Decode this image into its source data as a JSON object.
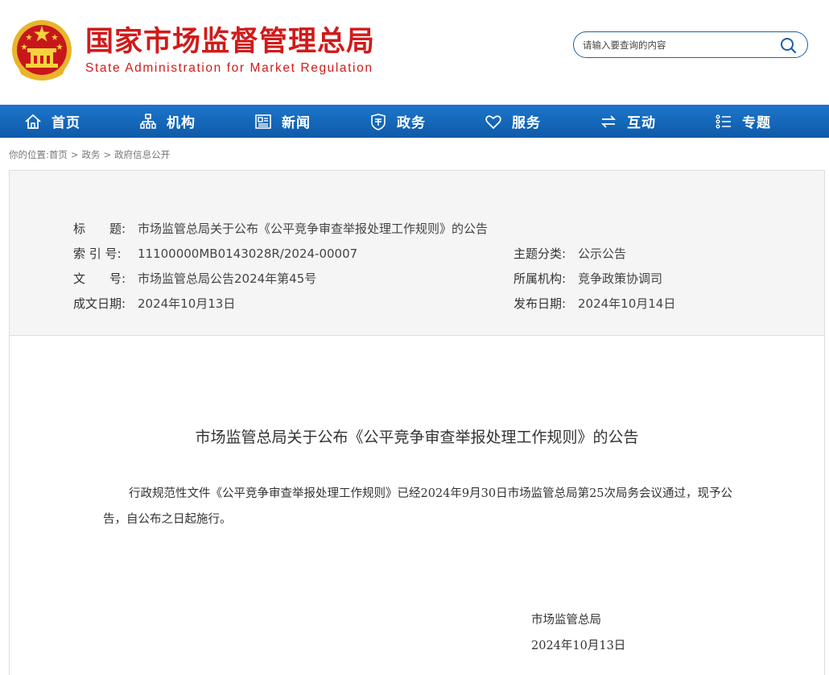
{
  "header": {
    "logo_cn": "国家市场监督管理总局",
    "logo_en": "State Administration for Market Regulation",
    "search_placeholder": "请输入要查询的内容",
    "brand_red": "#d11a1a",
    "brand_blue": "#1166bb"
  },
  "nav": {
    "items": [
      {
        "label": "首页",
        "icon": "home-icon"
      },
      {
        "label": "机构",
        "icon": "org-chart-icon"
      },
      {
        "label": "新闻",
        "icon": "news-icon"
      },
      {
        "label": "政务",
        "icon": "government-affairs-icon"
      },
      {
        "label": "服务",
        "icon": "heart-icon"
      },
      {
        "label": "互动",
        "icon": "exchange-icon"
      },
      {
        "label": "专题",
        "icon": "topics-list-icon"
      }
    ]
  },
  "breadcrumb": {
    "prefix": "你的位置:",
    "items": [
      "首页",
      "政务",
      "政府信息公开"
    ],
    "separator": ">"
  },
  "meta": {
    "title_label": "标　　题:",
    "title_value": "市场监管总局关于公布《公平竞争审查举报处理工作规则》的公告",
    "index_label": "索 引 号:",
    "index_value": "11100000MB0143028R/2024-00007",
    "topic_label": "主题分类:",
    "topic_value": "公示公告",
    "docno_label": "文　　号:",
    "docno_value": "市场监管总局公告2024年第45号",
    "agency_label": "所属机构:",
    "agency_value": "竞争政策协调司",
    "written_label": "成文日期:",
    "written_value": "2024年10月13日",
    "published_label": "发布日期:",
    "published_value": "2024年10月14日"
  },
  "document": {
    "title": "市场监管总局关于公布《公平竞争审查举报处理工作规则》的公告",
    "body": "行政规范性文件《公平竞争审查举报处理工作规则》已经2024年9月30日市场监管总局第25次局务会议通过，现予公告，自公布之日起施行。",
    "signature": "市场监管总局",
    "date": "2024年10月13日"
  }
}
